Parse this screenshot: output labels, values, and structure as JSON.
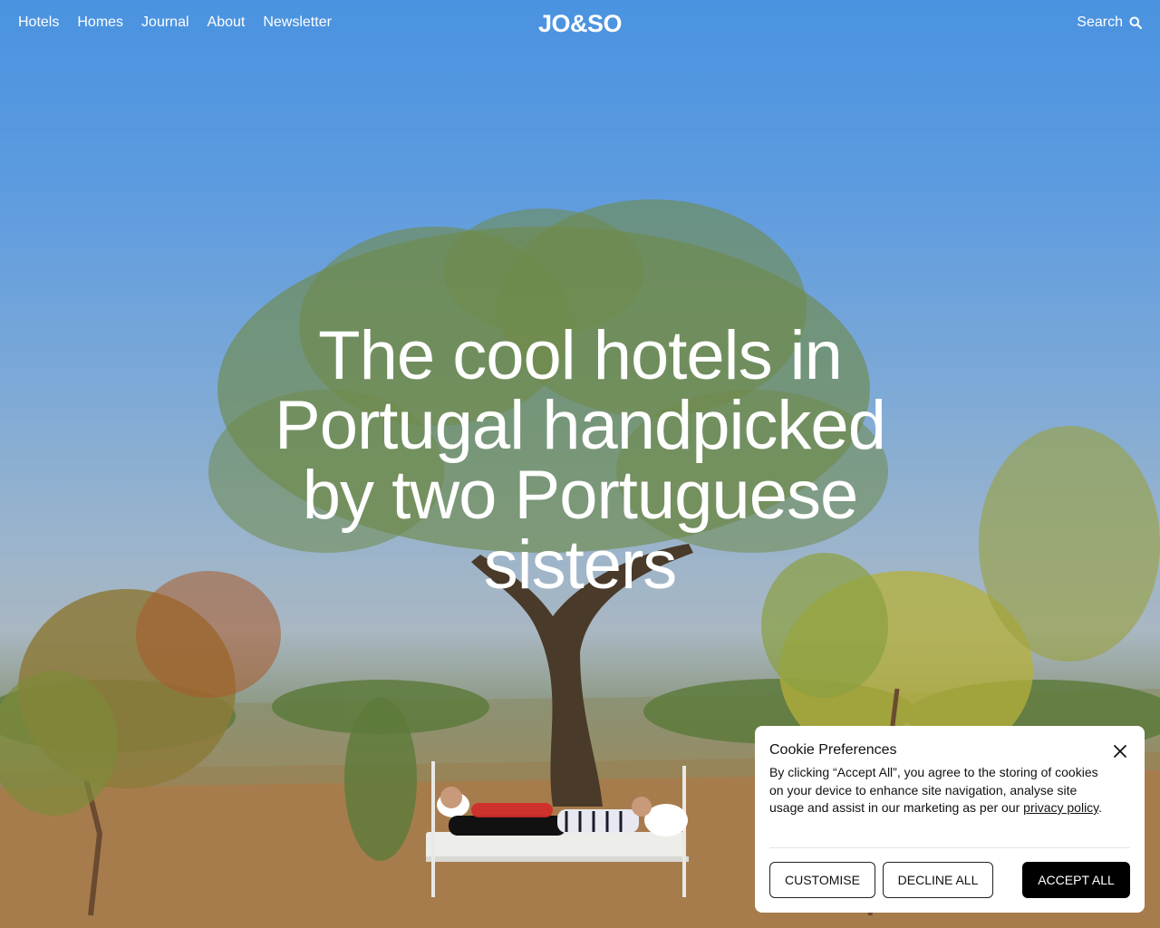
{
  "nav": {
    "links": [
      "Hotels",
      "Homes",
      "Journal",
      "About",
      "Newsletter"
    ],
    "logo": "JO&SO",
    "search_label": "Search",
    "search_icon": "search-icon"
  },
  "hero": {
    "title": "The cool hotels in Portugal handpicked by two Portuguese sisters"
  },
  "cookie": {
    "title": "Cookie Preferences",
    "text": "By clicking “Accept All”, you agree to the storing of cookies on your device to enhance site navigation, analyse site usage and assist in our marketing as per our ",
    "link_text": "privacy policy",
    "text_end": ".",
    "close_icon": "close-icon",
    "buttons": {
      "customise": "CUSTOMISE",
      "decline": "DECLINE ALL",
      "accept": "ACCEPT ALL"
    }
  },
  "colors": {
    "nav_text": "#ffffff",
    "accept_bg": "#000000",
    "dialog_bg": "#ffffff"
  }
}
